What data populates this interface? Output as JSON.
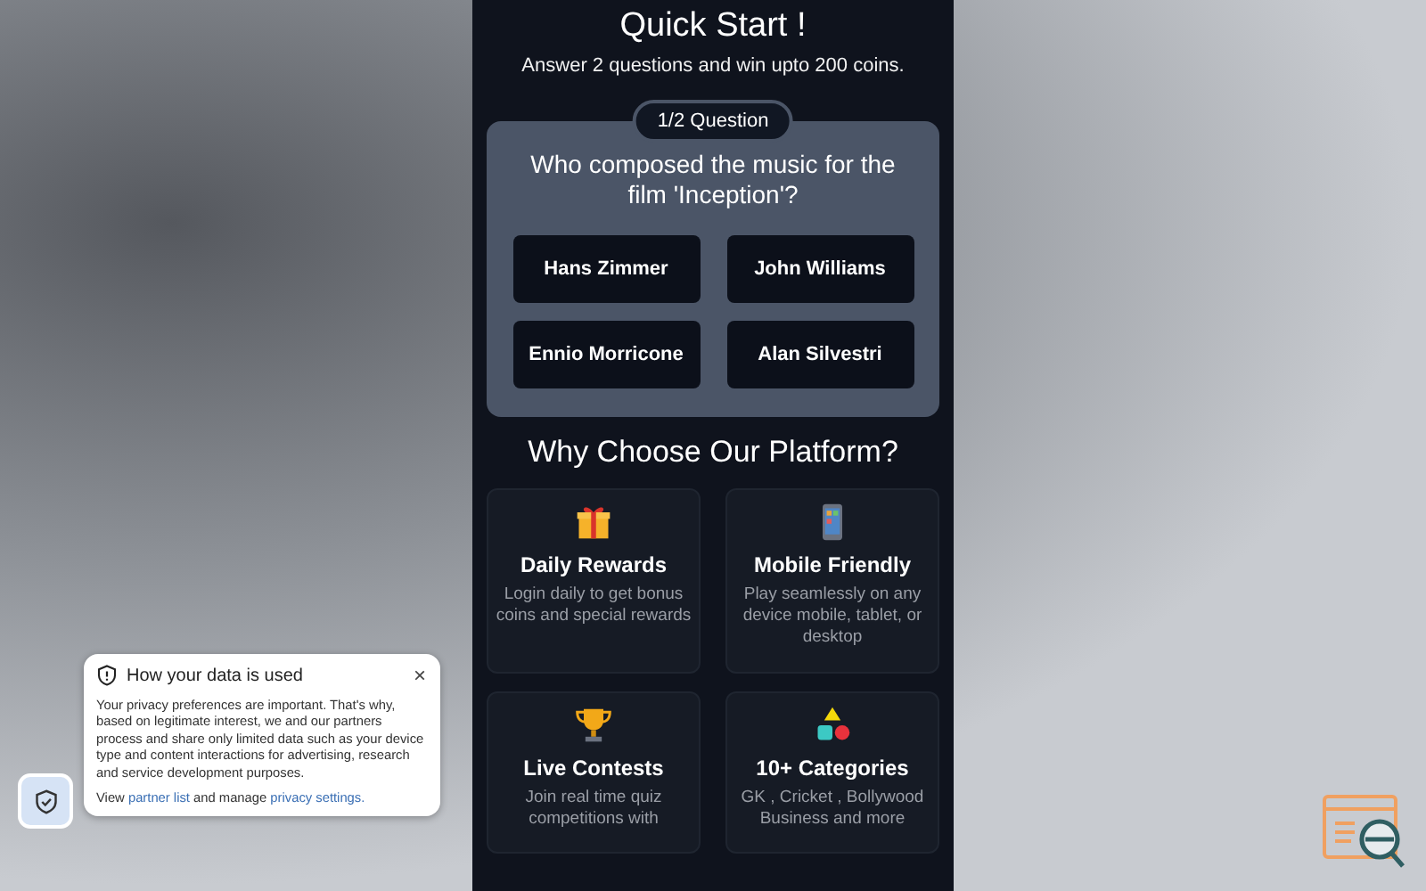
{
  "header": {
    "title": "Quick Start !",
    "subtitle": "Answer 2 questions and win upto 200 coins."
  },
  "quiz": {
    "counter": "1/2 Question",
    "question": "Who composed the music for the film 'Inception'?",
    "options": [
      {
        "label": "Hans Zimmer"
      },
      {
        "label": "John Williams"
      },
      {
        "label": "Ennio Morricone"
      },
      {
        "label": "Alan Silvestri"
      }
    ]
  },
  "features": {
    "title": "Why Choose Our Platform?",
    "cards": [
      {
        "kind": "gift",
        "title": "Daily Rewards",
        "text": "Login daily to get bonus coins and special rewards"
      },
      {
        "kind": "phone",
        "title": "Mobile Friendly",
        "text": "Play seamlessly on any device mobile, tablet, or desktop"
      },
      {
        "kind": "trophy",
        "title": "Live Contests",
        "text": "Join real time quiz competitions with"
      },
      {
        "kind": "shapes",
        "title": "10+ Categories",
        "text": "GK , Cricket , Bollywood Business and more"
      }
    ]
  },
  "privacy_notice": {
    "title": "How your data is used",
    "close": "×",
    "body": "Your privacy preferences are important. That's why, based on legitimate interest, we and our partners process and share only limited data such as your device type and content interactions for advertising, research and service development purposes.",
    "footer": [
      {
        "kind": "text",
        "text": "View "
      },
      {
        "kind": "link",
        "text": "partner list"
      },
      {
        "kind": "text",
        "text": " and manage "
      },
      {
        "kind": "link",
        "text": "privacy settings."
      }
    ]
  }
}
